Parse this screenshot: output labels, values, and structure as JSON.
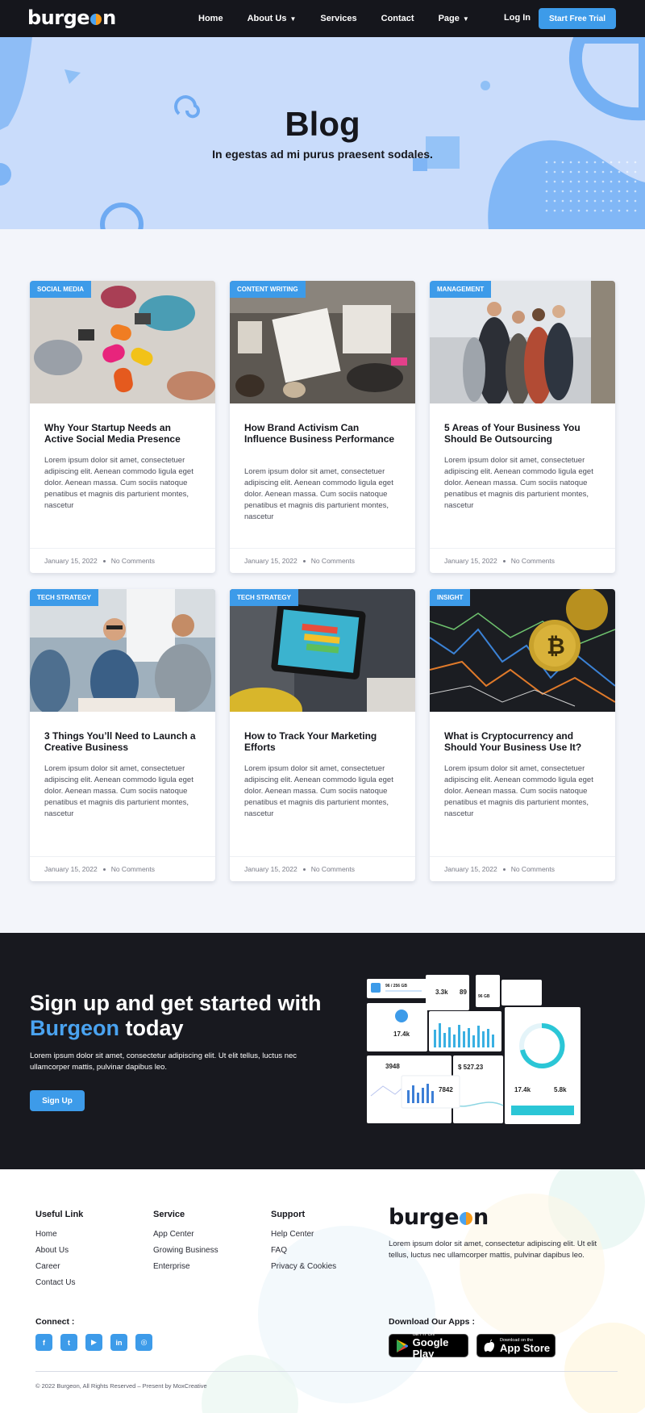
{
  "nav": {
    "logo_left": "burge",
    "logo_right": "n",
    "links": [
      "Home",
      "About Us",
      "Services",
      "Contact",
      "Page"
    ],
    "login": "Log In",
    "cta": "Start Free Trial"
  },
  "hero": {
    "title": "Blog",
    "subtitle": "In egestas ad mi purus praesent sodales."
  },
  "posts": [
    {
      "tag": "Social Media",
      "title": "Why Your Startup Needs an Active Social Media Presence",
      "excerpt": "Lorem ipsum dolor sit amet, consectetuer adipiscing elit. Aenean commodo ligula eget dolor. Aenean massa. Cum sociis natoque penatibus et magnis dis parturient montes, nascetur",
      "date": "January 15, 2022",
      "comments": "No Comments"
    },
    {
      "tag": "Content Writing",
      "title": "How Brand Activism Can Influence Business Performance",
      "excerpt": "Lorem ipsum dolor sit amet, consectetuer adipiscing elit. Aenean commodo ligula eget dolor. Aenean massa. Cum sociis natoque penatibus et magnis dis parturient montes, nascetur",
      "date": "January 15, 2022",
      "comments": "No Comments"
    },
    {
      "tag": "Management",
      "title": "5 Areas of Your Business You Should Be Outsourcing",
      "excerpt": "Lorem ipsum dolor sit amet, consectetuer adipiscing elit. Aenean commodo ligula eget dolor. Aenean massa. Cum sociis natoque penatibus et magnis dis parturient montes, nascetur",
      "date": "January 15, 2022",
      "comments": "No Comments"
    },
    {
      "tag": "Tech Strategy",
      "title": "3 Things You’ll Need to Launch a Creative Business",
      "excerpt": "Lorem ipsum dolor sit amet, consectetuer adipiscing elit. Aenean commodo ligula eget dolor. Aenean massa. Cum sociis natoque penatibus et magnis dis parturient montes, nascetur",
      "date": "January 15, 2022",
      "comments": "No Comments"
    },
    {
      "tag": "Tech Strategy",
      "title": "How to Track Your Marketing Efforts",
      "excerpt": "Lorem ipsum dolor sit amet, consectetuer adipiscing elit. Aenean commodo ligula eget dolor. Aenean massa. Cum sociis natoque penatibus et magnis dis parturient montes, nascetur",
      "date": "January 15, 2022",
      "comments": "No Comments"
    },
    {
      "tag": "Insight",
      "title": "What is Cryptocurrency and Should Your Business Use It?",
      "excerpt": "Lorem ipsum dolor sit amet, consectetuer adipiscing elit. Aenean commodo ligula eget dolor. Aenean massa. Cum sociis natoque penatibus et magnis dis parturient montes, nascetur",
      "date": "January 15, 2022",
      "comments": "No Comments"
    }
  ],
  "cta": {
    "title_1": "Sign up and get started with",
    "title_highlight": "Burgeon",
    "title_2": "today",
    "text": "Lorem ipsum dolor sit amet, consectetur adipiscing elit. Ut elit tellus, luctus nec ullamcorper mattis, pulvinar dapibus leo.",
    "button": "Sign Up",
    "dashboard": {
      "storage": "96 / 256 GB",
      "stat_a": "3.3k",
      "stat_b": "89",
      "stat_c": "96 GB",
      "stat_d": "17.4k",
      "stat_e": "3948",
      "stat_f": "$ 527.23",
      "stat_g": "7842",
      "stat_h": "17.4k",
      "stat_i": "5.8k"
    }
  },
  "footer": {
    "columns": [
      {
        "title": "Useful Link",
        "links": [
          "Home",
          "About Us",
          "Career",
          "Contact Us"
        ]
      },
      {
        "title": "Service",
        "links": [
          "App Center",
          "Growing Business",
          "Enterprise"
        ]
      },
      {
        "title": "Support",
        "links": [
          "Help Center",
          "FAQ",
          "Privacy & Cookies"
        ]
      }
    ],
    "logo_left": "burge",
    "logo_right": "n",
    "description": "Lorem ipsum dolor sit amet, consectetur adipiscing elit. Ut elit tellus, luctus nec ullamcorper mattis, pulvinar dapibus leo.",
    "connect": "Connect :",
    "download": "Download Our Apps :",
    "google": {
      "small": "GET IT ON",
      "big": "Google Play"
    },
    "apple": {
      "small": "Download on the",
      "big": "App Store"
    },
    "copyright": "© 2022 Burgeon, All Rights Reserved – Present by MoxCreative"
  },
  "colors": {
    "accent": "#3d9be9",
    "dark": "#15161c",
    "hero_bg": "#c9dcfb"
  }
}
